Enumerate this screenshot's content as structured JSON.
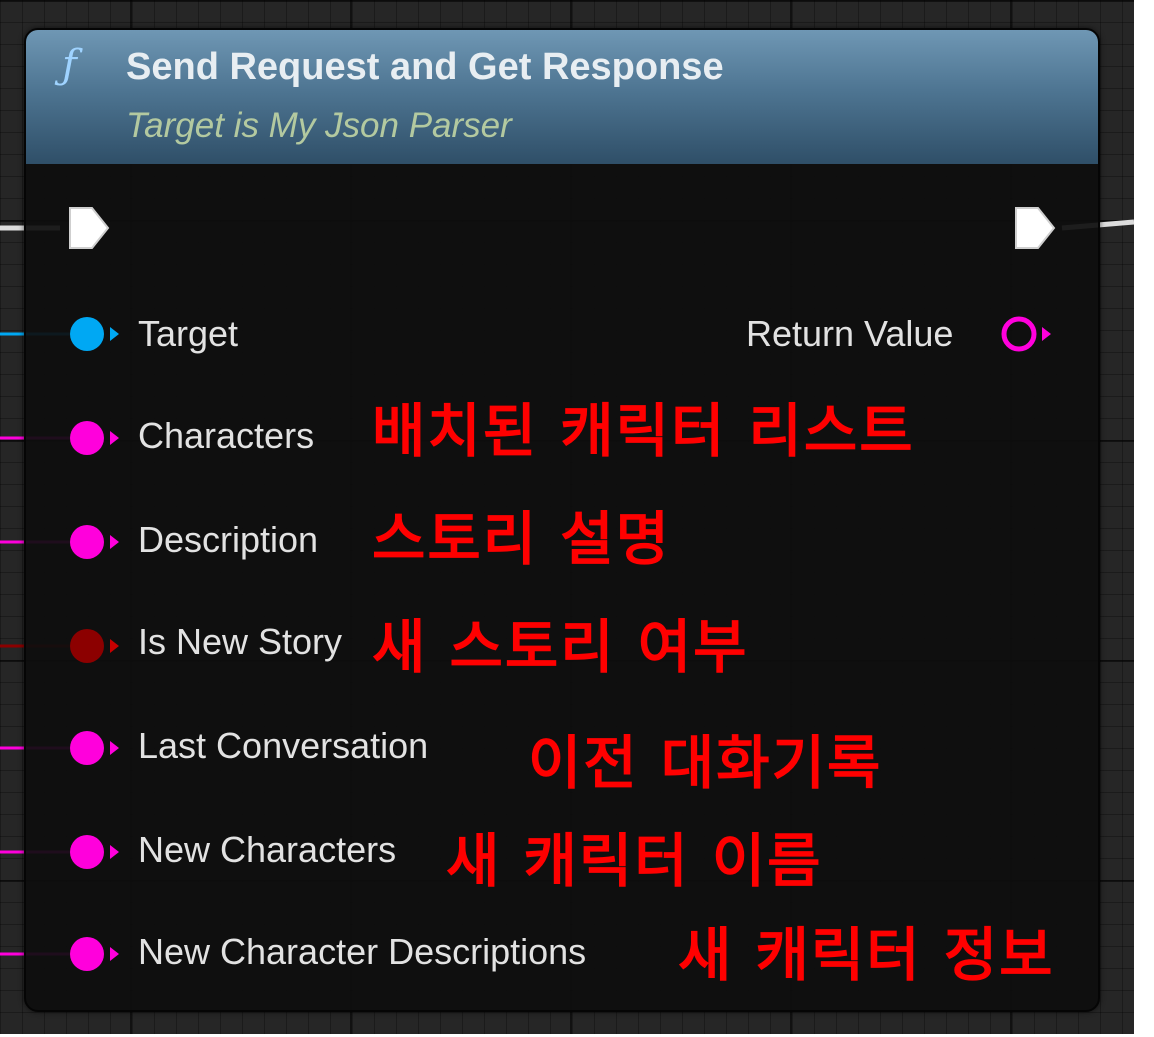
{
  "node": {
    "title": "Send Request and Get Response",
    "subtitle": "Target is My Json Parser",
    "icon": "function-icon"
  },
  "pins": {
    "target": "Target",
    "return_value": "Return Value",
    "characters": "Characters",
    "description": "Description",
    "is_new_story": "Is New Story",
    "last_conversation": "Last Conversation",
    "new_characters": "New Characters",
    "new_character_descriptions": "New Character Descriptions"
  },
  "annotations": {
    "characters": "배치된 캐릭터 리스트",
    "description": "스토리 설명",
    "is_new_story": "새 스토리 여부",
    "last_conversation": "이전 대화기록",
    "new_characters": "새 캐릭터 이름",
    "new_character_descriptions": "새 캐릭터 정보"
  },
  "colors": {
    "object_pin": "#00a8f3",
    "string_pin": "#ff00dc",
    "bool_pin": "#8c0000",
    "exec_pin": "#ffffff",
    "annotation": "#ff0000"
  }
}
